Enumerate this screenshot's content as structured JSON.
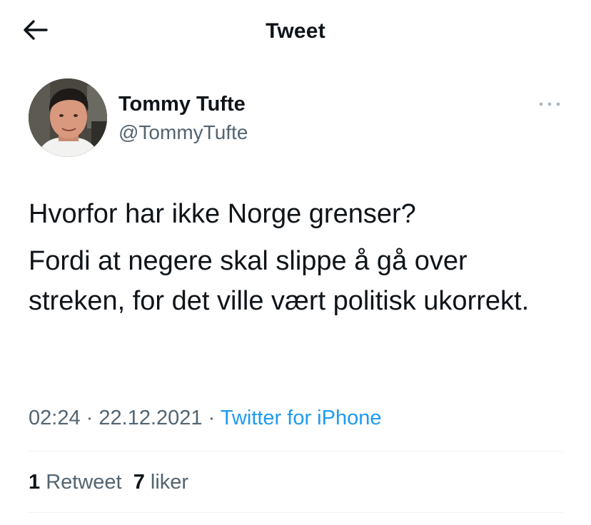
{
  "header": {
    "title": "Tweet",
    "back_icon": "arrow-left-icon"
  },
  "author": {
    "name": "Tommy Tufte",
    "handle": "@TommyTufte",
    "avatar_icon": "avatar-photo"
  },
  "more_icon": "more-horizontal-icon",
  "tweet": {
    "paragraphs": [
      "Hvorfor har ikke Norge grenser?",
      "Fordi at negere skal slippe å gå over streken, for det ville vært politisk ukorrekt."
    ]
  },
  "meta": {
    "time": "02:24",
    "separator": "·",
    "date": "22.12.2021",
    "source": "Twitter for iPhone"
  },
  "stats": {
    "retweets_count": "1",
    "retweets_label": "Retweet",
    "likes_count": "7",
    "likes_label": "liker"
  },
  "colors": {
    "text": "#0f1419",
    "secondary": "#536471",
    "accent": "#1d9bf0",
    "divider": "#eff3f4"
  }
}
